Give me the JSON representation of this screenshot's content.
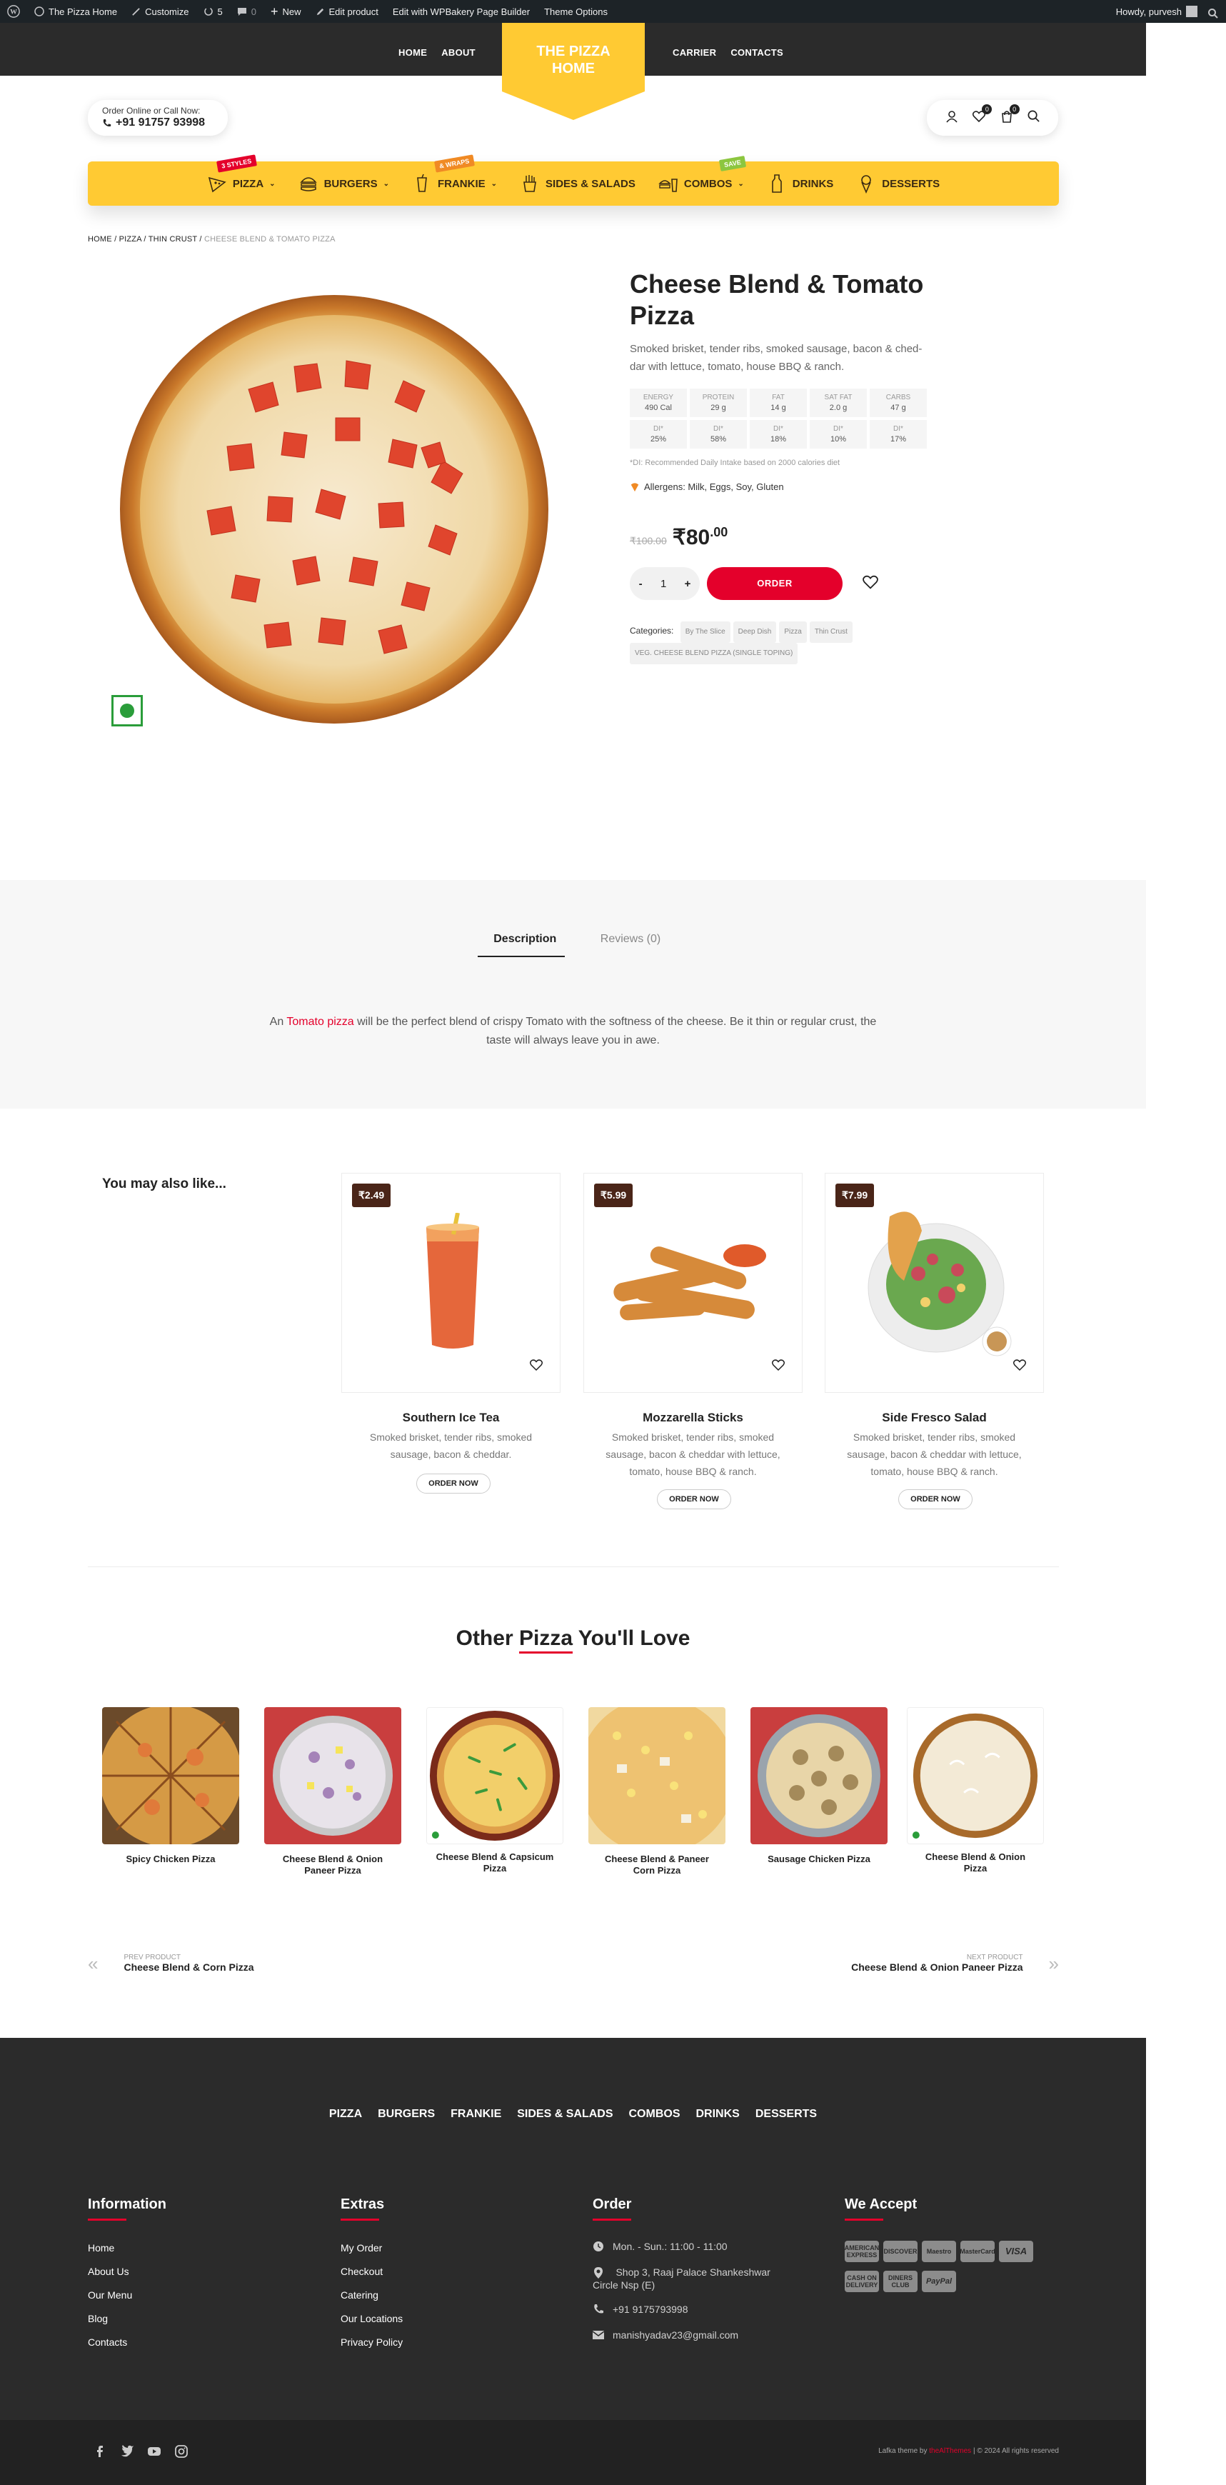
{
  "adminbar": {
    "site": "The Pizza Home",
    "customize": "Customize",
    "updates": "5",
    "comments": "0",
    "new": "New",
    "edit": "Edit product",
    "wpbakery": "Edit with WPBakery Page Builder",
    "theme_options": "Theme Options",
    "howdy": "Howdy, purvesh"
  },
  "header": {
    "nav_left": [
      "HOME",
      "ABOUT"
    ],
    "nav_right": [
      "CARRIER",
      "CONTACTS"
    ],
    "logo_line1": "THE PIZZA",
    "logo_line2": "HOME",
    "order_label": "Order Online or Call Now:",
    "phone": "+91 91757 93998",
    "wishlist_count": "0",
    "cart_count": "0"
  },
  "categories": [
    {
      "label": "PIZZA",
      "badge": "3 STYLES",
      "badge_color": "#e4002b",
      "icon": "pizza-slice-icon",
      "dropdown": true
    },
    {
      "label": "BURGERS",
      "badge": "",
      "icon": "burger-icon",
      "dropdown": true
    },
    {
      "label": "FRANKIE",
      "badge": "& WRAPS",
      "badge_color": "#f08a24",
      "icon": "drink-cup-icon",
      "dropdown": true
    },
    {
      "label": "SIDES & SALADS",
      "badge": "",
      "icon": "fries-icon",
      "dropdown": false
    },
    {
      "label": "COMBOS",
      "badge": "SAVE",
      "badge_color": "#8cc63f",
      "icon": "combo-icon",
      "dropdown": true
    },
    {
      "label": "DRINKS",
      "badge": "",
      "icon": "bottle-icon",
      "dropdown": false
    },
    {
      "label": "DESSERTS",
      "badge": "",
      "icon": "ice-cream-icon",
      "dropdown": false
    }
  ],
  "breadcrumb": [
    "HOME",
    "PIZZA",
    "THIN CRUST",
    "CHEESE BLEND & TOMATO PIZZA"
  ],
  "product": {
    "title_line1": "Cheese Blend & Tomato",
    "title_line2": "Pizza",
    "desc_line1": "Smoked brisket, tender ribs, smoked sausage, bacon & ched-",
    "desc_line2": "dar with lettuce, tomato, house BBQ & ranch.",
    "nutrition": [
      {
        "name": "ENERGY",
        "value": "490 Cal",
        "di": "25%"
      },
      {
        "name": "PROTEIN",
        "value": "29 g",
        "di": "58%"
      },
      {
        "name": "FAT",
        "value": "14 g",
        "di": "18%"
      },
      {
        "name": "SAT FAT",
        "value": "2.0 g",
        "di": "10%"
      },
      {
        "name": "CARBS",
        "value": "47 g",
        "di": "17%"
      }
    ],
    "di_label": "DI*",
    "di_note": "*DI: Recommended Daily Intake based on 2000 calories diet",
    "allergens": "Allergens: Milk, Eggs, Soy, Gluten",
    "old_price": "₹100.00",
    "price_main": "₹80",
    "price_cents": ".00",
    "qty": "1",
    "minus": "-",
    "plus": "+",
    "order_label": "ORDER",
    "categories_label": "Categories:",
    "tags": [
      "By The Slice",
      "Deep Dish",
      "Pizza",
      "Thin Crust"
    ],
    "sku_tag": "VEG. CHEESE BLEND PIZZA (SINGLE TOPING)"
  },
  "tabs": {
    "items": [
      "Description",
      "Reviews (0)"
    ],
    "desc_pre": "An ",
    "desc_link": "Tomato pizza",
    "desc_post": " will be the perfect blend of crispy Tomato with the softness of the cheese. Be it thin or regular crust, the",
    "desc_line2": "taste will always leave you in awe."
  },
  "related": {
    "heading": "You may also like...",
    "items": [
      {
        "price": "₹2.49",
        "title": "Southern Ice Tea",
        "desc1": "Smoked brisket, tender ribs, smoked",
        "desc2": "sausage, bacon & cheddar.",
        "desc3": "",
        "btn": "ORDER NOW"
      },
      {
        "price": "₹5.99",
        "title": "Mozzarella Sticks",
        "desc1": "Smoked brisket, tender ribs, smoked",
        "desc2": "sausage, bacon & cheddar with lettuce,",
        "desc3": "tomato, house BBQ & ranch.",
        "btn": "ORDER NOW"
      },
      {
        "price": "₹7.99",
        "title": "Side Fresco Salad",
        "desc1": "Smoked brisket, tender ribs, smoked",
        "desc2": "sausage, bacon & cheddar with lettuce,",
        "desc3": "tomato, house BBQ & ranch.",
        "btn": "ORDER NOW"
      }
    ]
  },
  "other": {
    "heading_pre": "Other ",
    "heading_accent": "Pizza",
    "heading_post": " You'll Love",
    "items": [
      {
        "l1": "Spicy Chicken Pizza",
        "l2": ""
      },
      {
        "l1": "Cheese Blend & Onion",
        "l2": "Paneer Pizza"
      },
      {
        "l1": "Cheese Blend & Capsicum",
        "l2": "Pizza"
      },
      {
        "l1": "Cheese Blend & Paneer",
        "l2": "Corn Pizza"
      },
      {
        "l1": "Sausage Chicken Pizza",
        "l2": ""
      },
      {
        "l1": "Cheese Blend & Onion",
        "l2": "Pizza"
      }
    ]
  },
  "postnav": {
    "prev_label": "PREV PRODUCT",
    "prev_title": "Cheese Blend & Corn Pizza",
    "next_label": "NEXT PRODUCT",
    "next_title": "Cheese Blend & Onion Paneer Pizza"
  },
  "footer": {
    "cats": [
      "PIZZA",
      "BURGERS",
      "FRANKIE",
      "SIDES & SALADS",
      "COMBOS",
      "DRINKS",
      "DESSERTS"
    ],
    "info_head": "Information",
    "info_links": [
      "Home",
      "About Us",
      "Our Menu",
      "Blog",
      "Contacts"
    ],
    "extras_head": "Extras",
    "extras_links": [
      "My Order",
      "Checkout",
      "Catering",
      "Our Locations",
      "Privacy Policy"
    ],
    "order_head": "Order",
    "hours": "Mon. - Sun.: 11:00 - 11:00",
    "addr1": "Shop 3, Raaj Palace Shankeshwar",
    "addr2": "Circle Nsp (E)",
    "phone": "+91 9175793998",
    "email": "manishyadav23@gmail.com",
    "accept_head": "We Accept",
    "payments": [
      "AMERICAN EXPRESS",
      "DISCOVER",
      "Maestro",
      "MasterCard",
      "VISA",
      "CASH ON DELIVERY",
      "DINERS CLUB",
      "PayPal"
    ],
    "copyright_pre": "Lafka theme by ",
    "copyright_link": "theAlThemes",
    "copyright_post": " | © 2024 All rights reserved"
  }
}
